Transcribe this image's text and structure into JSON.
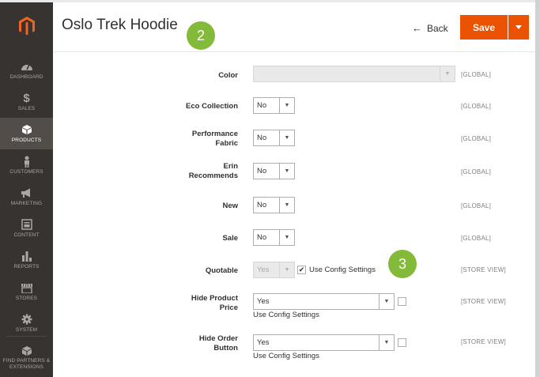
{
  "sidebar": {
    "items": [
      {
        "label": "DASHBOARD",
        "icon": "dashboard-icon"
      },
      {
        "label": "SALES",
        "icon": "dollar-icon"
      },
      {
        "label": "PRODUCTS",
        "icon": "cube-icon",
        "active": true
      },
      {
        "label": "CUSTOMERS",
        "icon": "person-icon"
      },
      {
        "label": "MARKETING",
        "icon": "megaphone-icon"
      },
      {
        "label": "CONTENT",
        "icon": "content-icon"
      },
      {
        "label": "REPORTS",
        "icon": "bar-chart-icon"
      },
      {
        "label": "STORES",
        "icon": "store-icon"
      },
      {
        "label": "SYSTEM",
        "icon": "gear-icon"
      },
      {
        "label": "FIND PARTNERS & EXTENSIONS",
        "icon": "extensions-icon"
      }
    ]
  },
  "header": {
    "title": "Oslo Trek Hoodie",
    "back_label": "Back",
    "save_label": "Save"
  },
  "badges": {
    "first": "2",
    "second": "3"
  },
  "form": {
    "color": {
      "label": "Color",
      "value": "",
      "scope": "[GLOBAL]"
    },
    "eco": {
      "label": "Eco Collection",
      "value": "No",
      "scope": "[GLOBAL]"
    },
    "performance": {
      "label": "Performance Fabric",
      "value": "No",
      "scope": "[GLOBAL]"
    },
    "erin": {
      "label": "Erin Recommends",
      "value": "No",
      "scope": "[GLOBAL]"
    },
    "new": {
      "label": "New",
      "value": "No",
      "scope": "[GLOBAL]"
    },
    "sale": {
      "label": "Sale",
      "value": "No",
      "scope": "[GLOBAL]"
    },
    "quotable": {
      "label": "Quotable",
      "value": "Yes",
      "config_label": "Use Config Settings",
      "scope": "[STORE VIEW]"
    },
    "hide_price": {
      "label": "Hide Product Price",
      "value": "Yes",
      "config_label": "Use Config Settings",
      "scope": "[STORE VIEW]"
    },
    "hide_order": {
      "label": "Hide Order Button",
      "value": "Yes",
      "config_label": "Use Config Settings",
      "scope": "[STORE VIEW]"
    }
  },
  "colors": {
    "accent": "#eb5202",
    "badge": "#83ba3a",
    "sidebar": "#373330"
  }
}
